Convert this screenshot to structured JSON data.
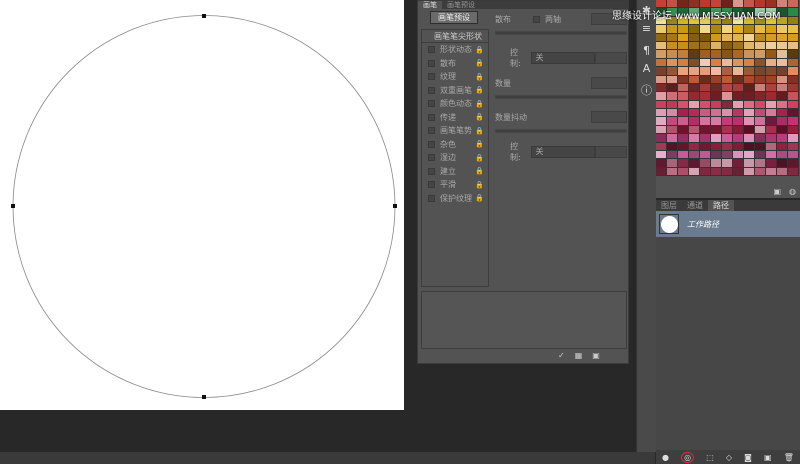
{
  "brush_panel": {
    "tabs": [
      "画笔",
      "画笔预设"
    ],
    "preset_button": "画笔预设",
    "list_header": "画笔笔尖形状",
    "items": [
      "形状动态",
      "散布",
      "纹理",
      "双重画笔",
      "颜色动态",
      "传递",
      "画笔笔势",
      "杂色",
      "湿边",
      "建立",
      "平滑",
      "保护纹理"
    ],
    "lock_glyph": "🔒",
    "scatter_label": "散布",
    "both_axes_label": "两轴",
    "control_label": "控制:",
    "control_value": "关",
    "count_label": "数量",
    "count_jitter_label": "数量抖动",
    "control2_label": "控制:",
    "control2_value": "关"
  },
  "layers_panel": {
    "tabs": [
      "图层",
      "通道",
      "路径"
    ],
    "active_tab": "路径",
    "path_name": "工作路径"
  },
  "watermark": "思缘设计论坛 www.MISSYUAN.COM",
  "swatch_rows": [
    "#c0392b",
    "#2a8a4a",
    "#d8c020",
    "#e0b010",
    "#d8a020",
    "#c89020",
    "#b87020",
    "#d88040",
    "#e08050",
    "#c05030",
    "#b04040",
    "#c03040",
    "#d04060",
    "#b02050",
    "#c03070",
    "#a02040",
    "#c04080",
    "#902040",
    "#d060a0",
    "#802040",
    "#a03050"
  ]
}
